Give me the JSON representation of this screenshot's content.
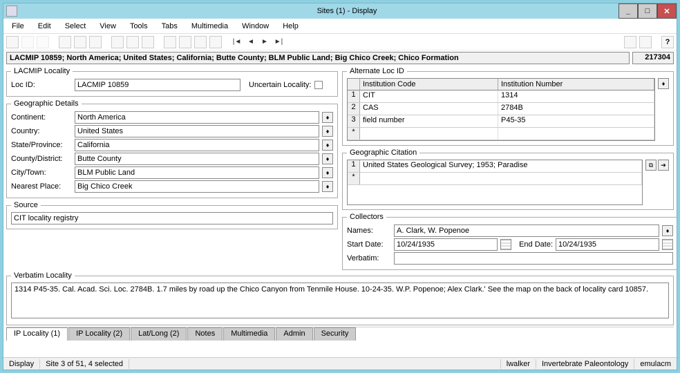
{
  "window": {
    "title": "Sites (1) - Display"
  },
  "title_buttons": {
    "min": "_",
    "max": "□",
    "close": "✕"
  },
  "menu": [
    "File",
    "Edit",
    "Select",
    "View",
    "Tools",
    "Tabs",
    "Multimedia",
    "Window",
    "Help"
  ],
  "nav": {
    "first": "|◄",
    "prev": "◄",
    "next": "►",
    "last": "►|"
  },
  "breadcrumb": "LACMIP 10859; North America; United States; California; Butte County; BLM Public Land; Big Chico Creek; Chico Formation",
  "record_id": "217304",
  "lacmip": {
    "legend": "LACMIP Locality",
    "loc_id_label": "Loc ID:",
    "loc_id": "LACMIP 10859",
    "uncertain_label": "Uncertain Locality:"
  },
  "geo": {
    "legend": "Geographic Details",
    "continent_label": "Continent:",
    "continent": "North America",
    "country_label": "Country:",
    "country": "United States",
    "state_label": "State/Province:",
    "state": "California",
    "county_label": "County/District:",
    "county": "Butte County",
    "city_label": "City/Town:",
    "city": "BLM Public Land",
    "nearest_label": "Nearest Place:",
    "nearest": "Big Chico Creek"
  },
  "source": {
    "legend": "Source",
    "value": "CIT locality registry"
  },
  "alt": {
    "legend": "Alternate Loc ID",
    "col_code": "Institution Code",
    "col_num": "Institution Number",
    "rows": [
      {
        "n": "1",
        "code": "CIT",
        "num": "1314"
      },
      {
        "n": "2",
        "code": "CAS",
        "num": "2784B"
      },
      {
        "n": "3",
        "code": "field number",
        "num": "P45-35"
      }
    ]
  },
  "citation": {
    "legend": "Geographic Citation",
    "rows": [
      {
        "n": "1",
        "text": "United States Geological Survey; 1953; Paradise"
      }
    ]
  },
  "collectors": {
    "legend": "Collectors",
    "names_label": "Names:",
    "names": "A. Clark, W. Popenoe",
    "start_label": "Start Date:",
    "start": "10/24/1935",
    "end_label": "End Date:",
    "end": "10/24/1935",
    "verbatim_label": "Verbatim:",
    "verbatim": ""
  },
  "verbatim_locality": {
    "legend": "Verbatim Locality",
    "value": "1314 P45-35. Cal. Acad. Sci. Loc. 2784B. 1.7 miles by road up the Chico Canyon from Tenmile House. 10-24-35. W.P. Popenoe; Alex Clark.' See the map on the back of locality card 10857."
  },
  "tabs": [
    "IP Locality (1)",
    "IP Locality (2)",
    "Lat/Long (2)",
    "Notes",
    "Multimedia",
    "Admin",
    "Security"
  ],
  "status": {
    "mode": "Display",
    "position": "Site 3 of 51, 4 selected",
    "user": "lwalker",
    "module": "Invertebrate Paleontology",
    "server": "emulacm"
  }
}
